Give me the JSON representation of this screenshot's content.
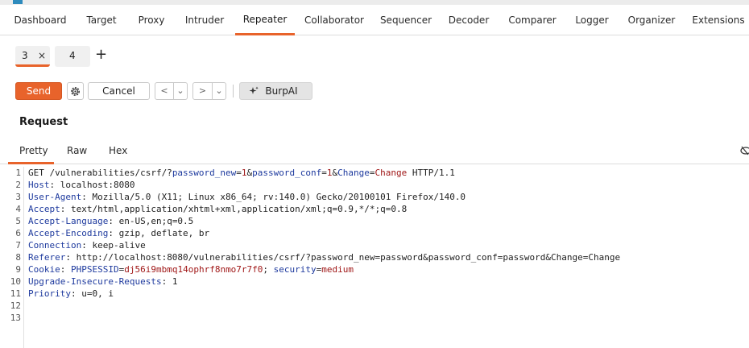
{
  "tabs": [
    "Dashboard",
    "Target",
    "Proxy",
    "Intruder",
    "Repeater",
    "Collaborator",
    "Sequencer",
    "Decoder",
    "Comparer",
    "Logger",
    "Organizer",
    "Extensions"
  ],
  "active_tab": "Repeater",
  "subtabs": [
    {
      "label": "3",
      "close": "×"
    },
    {
      "label": "4"
    }
  ],
  "add_tab": "+",
  "toolbar": {
    "send": "Send",
    "cancel": "Cancel",
    "burpai": "BurpAI",
    "prev": "<",
    "next": ">",
    "dropdown": "⌄"
  },
  "request": {
    "title": "Request",
    "views": [
      "Pretty",
      "Raw",
      "Hex"
    ],
    "lines": [
      {
        "n": "1",
        "parts": [
          {
            "t": "GET /vulnerabilities/csrf/?"
          },
          {
            "t": "password_new",
            "c": "p"
          },
          {
            "t": "="
          },
          {
            "t": "1",
            "c": "v"
          },
          {
            "t": "&"
          },
          {
            "t": "password_conf",
            "c": "p"
          },
          {
            "t": "="
          },
          {
            "t": "1",
            "c": "v"
          },
          {
            "t": "&"
          },
          {
            "t": "Change",
            "c": "p"
          },
          {
            "t": "="
          },
          {
            "t": "Change",
            "c": "v"
          },
          {
            "t": " HTTP/1.1"
          }
        ]
      },
      {
        "n": "2",
        "parts": [
          {
            "t": "Host",
            "c": "k"
          },
          {
            "t": ": localhost:8080"
          }
        ]
      },
      {
        "n": "3",
        "parts": [
          {
            "t": "User-Agent",
            "c": "k"
          },
          {
            "t": ": Mozilla/5.0 (X11; Linux x86_64; rv:140.0) Gecko/20100101 Firefox/140.0"
          }
        ]
      },
      {
        "n": "4",
        "parts": [
          {
            "t": "Accept",
            "c": "k"
          },
          {
            "t": ": text/html,application/xhtml+xml,application/xml;q=0.9,*/*;q=0.8"
          }
        ]
      },
      {
        "n": "5",
        "parts": [
          {
            "t": "Accept-Language",
            "c": "k"
          },
          {
            "t": ": en-US,en;q=0.5"
          }
        ]
      },
      {
        "n": "6",
        "parts": [
          {
            "t": "Accept-Encoding",
            "c": "k"
          },
          {
            "t": ": gzip, deflate, br"
          }
        ]
      },
      {
        "n": "7",
        "parts": [
          {
            "t": "Connection",
            "c": "k"
          },
          {
            "t": ": keep-alive"
          }
        ]
      },
      {
        "n": "8",
        "parts": [
          {
            "t": "Referer",
            "c": "k"
          },
          {
            "t": ": http://localhost:8080/vulnerabilities/csrf/?password_new=password&password_conf=password&Change=Change"
          }
        ]
      },
      {
        "n": "9",
        "parts": [
          {
            "t": "Cookie",
            "c": "k"
          },
          {
            "t": ": "
          },
          {
            "t": "PHPSESSID",
            "c": "p"
          },
          {
            "t": "="
          },
          {
            "t": "dj56i9mbmq14ophrf8nmo7r7f0",
            "c": "v"
          },
          {
            "t": "; "
          },
          {
            "t": "security",
            "c": "p"
          },
          {
            "t": "="
          },
          {
            "t": "medium",
            "c": "v"
          }
        ]
      },
      {
        "n": "10",
        "parts": [
          {
            "t": "Upgrade-Insecure-Requests",
            "c": "k"
          },
          {
            "t": ": 1"
          }
        ]
      },
      {
        "n": "11",
        "parts": [
          {
            "t": "Priority",
            "c": "k"
          },
          {
            "t": ": u=0, i"
          }
        ]
      },
      {
        "n": "12",
        "parts": []
      },
      {
        "n": "13",
        "parts": []
      }
    ]
  }
}
